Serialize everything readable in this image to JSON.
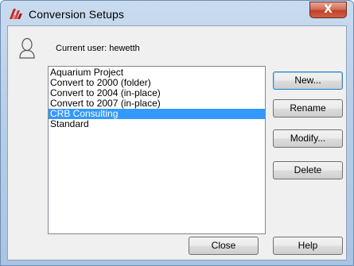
{
  "window": {
    "title": "Conversion Setups",
    "close_glyph": "X"
  },
  "user": {
    "label": "Current user: hewetth"
  },
  "setups": [
    {
      "label": "Aquarium Project",
      "selected": false
    },
    {
      "label": "Convert to 2000 (folder)",
      "selected": false
    },
    {
      "label": "Convert to 2004 (in-place)",
      "selected": false
    },
    {
      "label": "Convert to 2007 (in-place)",
      "selected": false
    },
    {
      "label": "CRB Consulting",
      "selected": true
    },
    {
      "label": "Standard",
      "selected": false
    }
  ],
  "buttons": {
    "new": "New...",
    "rename": "Rename",
    "modify": "Modify...",
    "delete": "Delete",
    "close": "Close",
    "help": "Help"
  },
  "icons": {
    "app": "autocad-app-icon",
    "user": "user-silhouette-icon",
    "close": "close-icon"
  },
  "colors": {
    "selection": "#3399ff",
    "close_button": "#c0412b",
    "frame": "#b9cfe7"
  }
}
